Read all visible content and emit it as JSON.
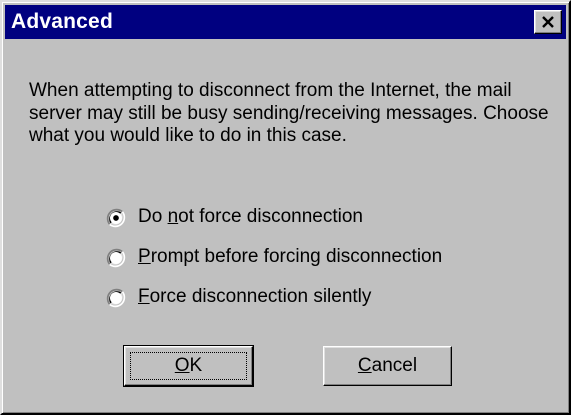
{
  "window": {
    "title": "Advanced",
    "close_label": "×"
  },
  "message": "When attempting to disconnect from the Internet, the mail server may still be busy sending/receiving messages. Choose what you would like to do in this case.",
  "options": [
    {
      "pre": "Do ",
      "mnemonic": "n",
      "post": "ot force disconnection",
      "selected": true
    },
    {
      "pre": "",
      "mnemonic": "P",
      "post": "rompt before forcing disconnection",
      "selected": false
    },
    {
      "pre": "",
      "mnemonic": "F",
      "post": "orce disconnection silently",
      "selected": false
    }
  ],
  "buttons": {
    "ok": {
      "mnemonic": "O",
      "rest": "K"
    },
    "cancel": {
      "mnemonic": "C",
      "rest": "ancel"
    }
  },
  "colors": {
    "titlebar": "#000080",
    "face": "#c0c0c0",
    "text": "#000000"
  }
}
